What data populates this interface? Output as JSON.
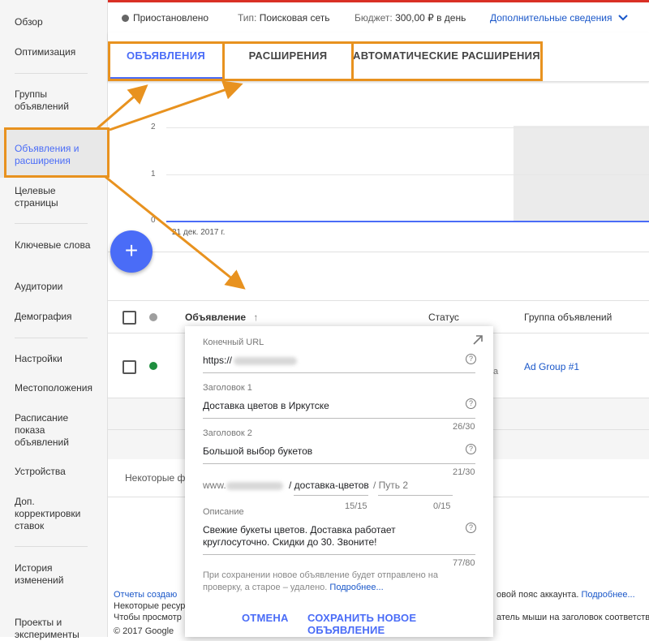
{
  "sidebar": {
    "items": [
      {
        "label": "Обзор"
      },
      {
        "label": "Оптимизация"
      },
      {
        "label": "Группы объявлений"
      },
      {
        "label": "Объявления и расширения"
      },
      {
        "label": "Целевые страницы"
      },
      {
        "label": "Ключевые слова"
      },
      {
        "label": "Аудитории"
      },
      {
        "label": "Демография"
      },
      {
        "label": "Настройки"
      },
      {
        "label": "Местоположения"
      },
      {
        "label": "Расписание показа объявлений"
      },
      {
        "label": "Устройства"
      },
      {
        "label": "Доп. корректировки ставок"
      },
      {
        "label": "История изменений"
      },
      {
        "label": "Проекты и эксперименты"
      }
    ]
  },
  "topbar": {
    "status": "Приостановлено",
    "type_label": "Тип:",
    "type_value": "Поисковая сеть",
    "budget_label": "Бюджет:",
    "budget_value": "300,00 ₽ в день",
    "details": "Дополнительные сведения"
  },
  "tabs": [
    {
      "label": "ОБЪЯВЛЕНИЯ"
    },
    {
      "label": "РАСШИРЕНИЯ"
    },
    {
      "label": "АВТОМАТИЧЕСКИЕ РАСШИРЕНИЯ"
    }
  ],
  "chart": {
    "y_ticks": [
      "2",
      "1",
      "0"
    ],
    "x_label": "21 дек. 2017 г."
  },
  "fab": {
    "label": "+"
  },
  "table": {
    "columns": {
      "ad": "Объявление",
      "status": "Статус",
      "group": "Группа объявлений"
    },
    "row": {
      "status_partial": "а",
      "group": "Ad Group #1"
    },
    "notice_partial": "Некоторые ф"
  },
  "footer": {
    "line1_link": "Отчеты создаю",
    "line1_right": "овой пояс аккаунта.",
    "line1_right_link": "Подробнее...",
    "line2": "Некоторые ресур",
    "line3": "Чтобы просмотр",
    "line3_right": "атель мыши на заголовок соответств",
    "copyright": "© 2017 Google"
  },
  "popup": {
    "final_url_label": "Конечный URL",
    "final_url_value": "https://",
    "headline1_label": "Заголовок 1",
    "headline1_value": "Доставка цветов в Иркутске",
    "headline1_count": "26/30",
    "headline2_label": "Заголовок 2",
    "headline2_value": "Большой выбор букетов",
    "headline2_count": "21/30",
    "display_url_prefix": "www.",
    "path1_value": "/ доставка-цветов",
    "path2_placeholder": "/ Путь 2",
    "path1_count": "15/15",
    "path2_count": "0/15",
    "description_label": "Описание",
    "description_value": "Свежие букеты цветов. Доставка работает круглосуточно. Скидки до 30. Звоните!",
    "description_count": "77/80",
    "note": "При сохранении новое объявление будет отправлено на проверку, а старое – удалено.",
    "note_link": "Подробнее...",
    "cancel": "ОТМЕНА",
    "save": "СОХРАНИТЬ НОВОЕ ОБЪЯВЛЕНИЕ"
  },
  "colors": {
    "accent": "#4a6cf7",
    "highlight": "#e8921f",
    "status_dot_active": "#1e8e3e",
    "top_border": "#d93025"
  }
}
